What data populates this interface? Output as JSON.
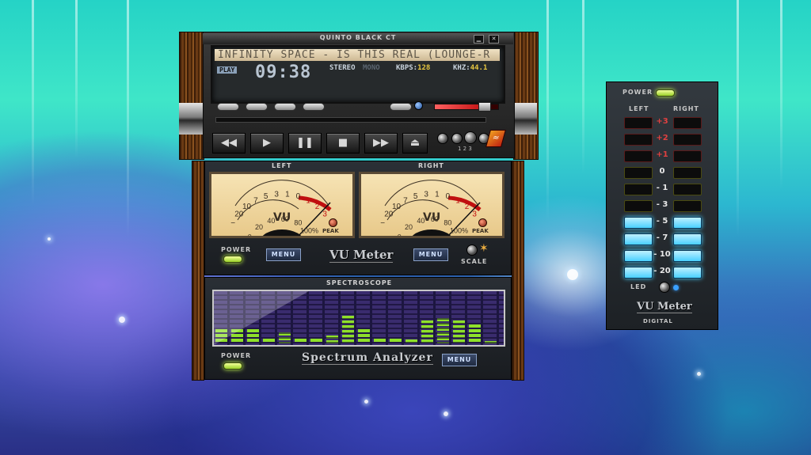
{
  "player": {
    "title": "QUINTO BLACK CT",
    "minimize": "▁",
    "close": "✕",
    "marquee": "INFINITY SPACE - IS THIS REAL (LOUNGE-R",
    "play_indicator": "PLAY",
    "time": "09:38",
    "stereo": "STEREO",
    "mono": "MONO",
    "kbps_label": "KBPS:",
    "kbps_value": "128",
    "khz_label": "KHZ:",
    "khz_value": "44.1",
    "volume_percent": 78,
    "controls": {
      "prev": "◀◀",
      "play": "▶",
      "pause": "❚❚",
      "stop": "■",
      "next": "▶▶",
      "eject": "⏏"
    },
    "mini_label": "1 2 3"
  },
  "vu_analog": {
    "left_label": "LEFT",
    "right_label": "RIGHT",
    "top_scale": [
      "−",
      "20",
      "10",
      "7",
      "5",
      "3",
      "1",
      "0",
      "1",
      "2",
      "3",
      "+"
    ],
    "bottom_scale": [
      "0",
      "20",
      "40",
      "60",
      "80",
      "100%"
    ],
    "vu": "VU",
    "peak": "PEAK",
    "power_label": "POWER",
    "menu_left": "MENU",
    "menu_right": "MENU",
    "brand": "VU Meter",
    "scale_label": "SCALE"
  },
  "spectroscope": {
    "title": "SPECTROSCOPE",
    "power_label": "POWER",
    "brand": "Spectrum Analyzer",
    "menu": "MENU",
    "levels": [
      0.28,
      0.28,
      0.28,
      0.1,
      0.22,
      0.1,
      0.1,
      0.16,
      0.55,
      0.28,
      0.1,
      0.1,
      0.08,
      0.45,
      0.5,
      0.45,
      0.38,
      0.05
    ]
  },
  "digital_vu": {
    "power_label": "POWER",
    "left_label": "LEFT",
    "right_label": "RIGHT",
    "levels": [
      {
        "label": "+3",
        "lit": false,
        "color": "#d23a3a"
      },
      {
        "label": "+2",
        "lit": false,
        "color": "#d23a3a"
      },
      {
        "label": "+1",
        "lit": false,
        "color": "#d23a3a"
      },
      {
        "label": "0",
        "lit": false,
        "color": "#d8dd2a"
      },
      {
        "label": "- 1",
        "lit": false,
        "color": "#d8dd2a"
      },
      {
        "label": "- 3",
        "lit": false,
        "color": "#d8dd2a"
      },
      {
        "label": "- 5",
        "lit": true,
        "color": "#4ad0ff"
      },
      {
        "label": "- 7",
        "lit": true,
        "color": "#4ad0ff"
      },
      {
        "label": "- 10",
        "lit": true,
        "color": "#4ad0ff"
      },
      {
        "label": "- 20",
        "lit": true,
        "color": "#4ad0ff"
      }
    ],
    "led_label": "LED",
    "brand": "VU Meter",
    "subtitle": "DIGITAL"
  }
}
